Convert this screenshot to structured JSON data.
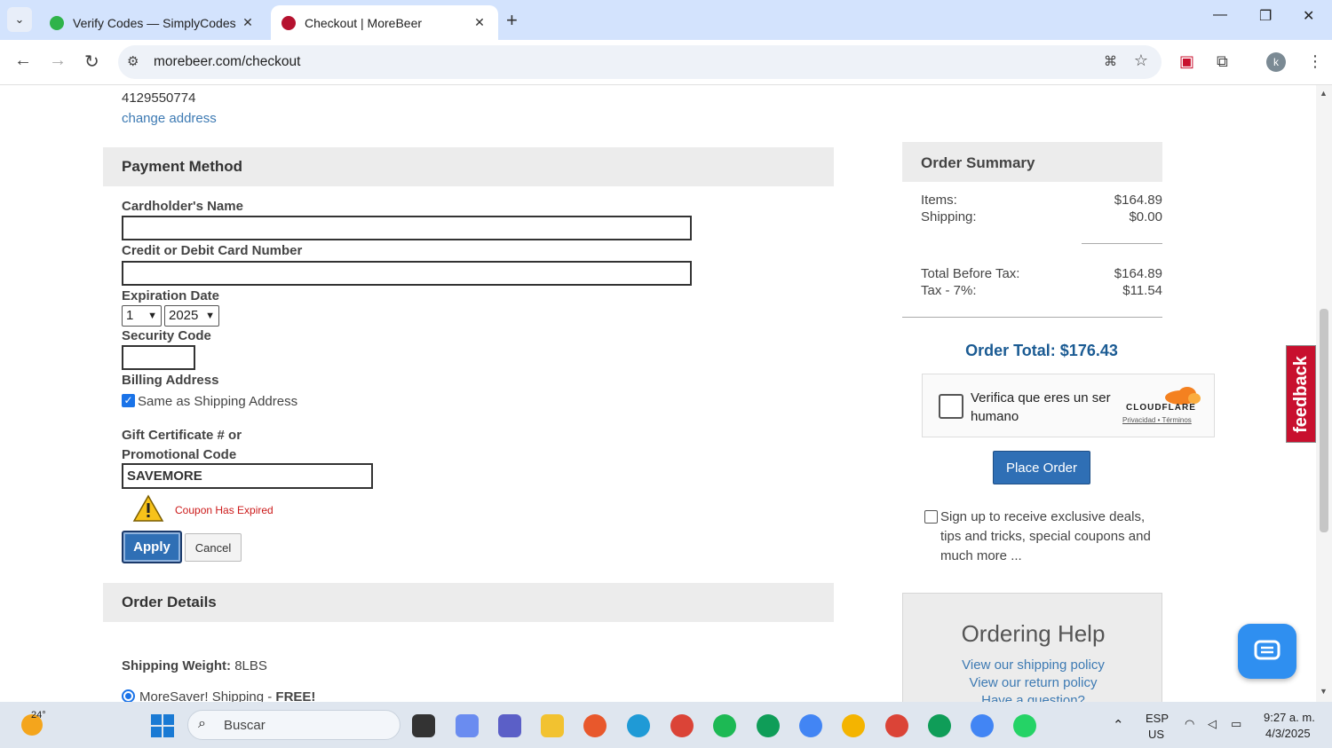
{
  "browser": {
    "tabs": [
      {
        "title": "Verify Codes — SimplyCodes",
        "active": false
      },
      {
        "title": "Checkout | MoreBeer",
        "active": true
      }
    ],
    "url": "morebeer.com/checkout"
  },
  "shipping": {
    "phone": "4129550774",
    "change_address": "change address"
  },
  "payment": {
    "header": "Payment Method",
    "cardholder_label": "Cardholder's Name",
    "card_number_label": "Credit or Debit Card Number",
    "expiration_label": "Expiration Date",
    "exp_month": "1",
    "exp_year": "2025",
    "security_label": "Security Code",
    "billing_label": "Billing Address",
    "same_as_shipping": "Same as Shipping Address",
    "gift_label": "Gift Certificate # or Promotional Code",
    "promo_value": "SAVEMORE",
    "coupon_error": "Coupon Has Expired",
    "apply": "Apply",
    "cancel": "Cancel"
  },
  "order_details": {
    "header": "Order Details",
    "shipping_weight_label": "Shipping Weight:",
    "shipping_weight_value": "8LBS",
    "shipping_option": "MoreSaver! Shipping - ",
    "shipping_option_price": "FREE!"
  },
  "summary": {
    "header": "Order Summary",
    "items_label": "Items:",
    "items_value": "$164.89",
    "shipping_label": "Shipping:",
    "shipping_value": "$0.00",
    "before_tax_label": "Total Before Tax:",
    "before_tax_value": "$164.89",
    "tax_label": "Tax - 7%:",
    "tax_value": "$11.54",
    "order_total": "Order Total: $176.43",
    "captcha_text": "Verifica que eres un ser humano",
    "cloudflare": "CLOUDFLARE",
    "captcha_links": "Privacidad • Términos",
    "place_order": "Place Order",
    "signup": "Sign up to receive exclusive deals, tips and tricks, special coupons and much more ..."
  },
  "help": {
    "title": "Ordering Help",
    "links": [
      "View our shipping policy",
      "View our return policy",
      "Have a question?"
    ]
  },
  "feedback": "feedback",
  "taskbar": {
    "temperature": "24°",
    "search_placeholder": "Buscar",
    "language": "ESP",
    "region": "US",
    "time": "9:27 a. m.",
    "date": "4/3/2025"
  },
  "colors": {
    "accent_blue": "#2f6fb5",
    "link_blue": "#3d7ab3",
    "error_red": "#cc1a1a",
    "feedback_red": "#c8102e"
  }
}
